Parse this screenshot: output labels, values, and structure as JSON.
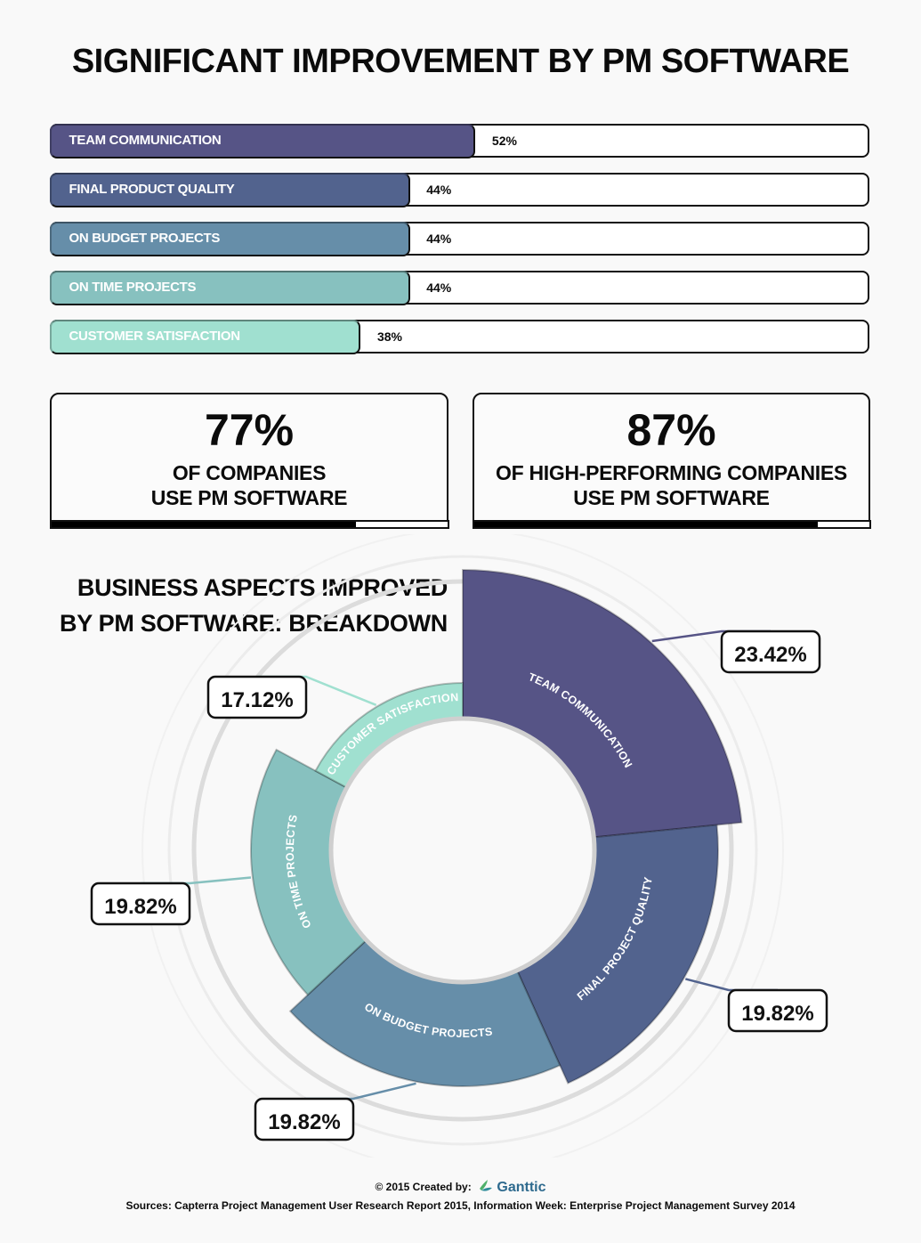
{
  "title": "SIGNIFICANT IMPROVEMENT BY PM SOFTWARE",
  "bars": {
    "max_percent": 100,
    "items": [
      {
        "label": "TEAM COMMUNICATION",
        "value": 52,
        "display": "52%",
        "color": "#565486"
      },
      {
        "label": "FINAL PRODUCT QUALITY",
        "value": 44,
        "display": "44%",
        "color": "#52638e"
      },
      {
        "label": "ON BUDGET PROJECTS",
        "value": 44,
        "display": "44%",
        "color": "#668ea9"
      },
      {
        "label": "ON TIME PROJECTS",
        "value": 44,
        "display": "44%",
        "color": "#87c1bf"
      },
      {
        "label": "CUSTOMER SATISFACTION",
        "value": 38,
        "display": "38%",
        "color": "#a0e0d0"
      }
    ]
  },
  "stats": [
    {
      "value": "77%",
      "line1": "OF COMPANIES",
      "line2": "USE PM SOFTWARE",
      "fill_percent": 77
    },
    {
      "value": "87%",
      "line1": "OF HIGH-PERFORMING COMPANIES",
      "line2": "USE PM SOFTWARE",
      "fill_percent": 87
    }
  ],
  "breakdown": {
    "title_line1": "BUSINESS ASPECTS IMPROVED",
    "title_line2": "BY PM SOFTWARE: BREAKDOWN"
  },
  "chart_data": {
    "type": "pie",
    "variant": "donut (radius varies by share)",
    "title": "BUSINESS ASPECTS IMPROVED BY PM SOFTWARE: BREAKDOWN",
    "start": "top, clockwise",
    "slices": [
      {
        "label": "TEAM COMMUNICATION",
        "value": 23.42,
        "display": "23.42%",
        "color": "#565486"
      },
      {
        "label": "FINAL PROJECT QUALITY",
        "value": 19.82,
        "display": "19.82%",
        "color": "#52638e"
      },
      {
        "label": "ON BUDGET PROJECTS",
        "value": 19.82,
        "display": "19.82%",
        "color": "#668ea9"
      },
      {
        "label": "ON TIME PROJECTS",
        "value": 19.82,
        "display": "19.82%",
        "color": "#87c1bf"
      },
      {
        "label": "CUSTOMER SATISFACTION",
        "value": 17.12,
        "display": "17.12%",
        "color": "#a0e0d0"
      }
    ]
  },
  "footer": {
    "created_by": "© 2015 Created by:",
    "brand": "Ganttic",
    "sources": "Sources: Capterra Project Management User Research Report 2015, Information Week: Enterprise Project Management Survey 2014"
  }
}
